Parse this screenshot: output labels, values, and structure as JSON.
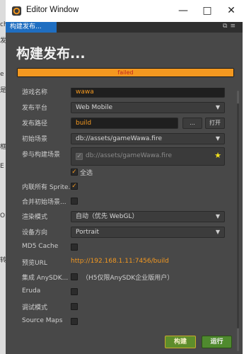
{
  "background_window": {
    "partial_labels": [
      "ch",
      "发",
      "e",
      "是",
      "框",
      "E",
      "O",
      "转"
    ]
  },
  "window": {
    "title": "Editor Window"
  },
  "tab": {
    "label": "构建发布..."
  },
  "panel": {
    "heading": "构建发布...",
    "progress": {
      "status": "failed",
      "fraction": 1.0,
      "color": "#f39820"
    }
  },
  "form": {
    "game_name": {
      "label": "游戏名称",
      "value": "wawa"
    },
    "platform": {
      "label": "发布平台",
      "value": "Web Mobile"
    },
    "path": {
      "label": "发布路径",
      "value": "build",
      "browse_label": "...",
      "open_label": "打开"
    },
    "start_scene": {
      "label": "初始场景",
      "value": "db://assets/gameWawa.fire"
    },
    "build_scenes": {
      "label": "参与构建场景",
      "scene": "db://assets/gameWawa.fire",
      "select_all": "全选"
    },
    "inline_sprite": {
      "label": "内联所有 Sprite...",
      "checked": true
    },
    "merge_scene": {
      "label": "合并初始场景...",
      "checked": false
    },
    "render_mode": {
      "label": "渲染模式",
      "value": "自动（优先 WebGL）"
    },
    "orientation": {
      "label": "设备方向",
      "value": "Portrait"
    },
    "md5": {
      "label": "MD5 Cache",
      "checked": false
    },
    "preview_url": {
      "label": "预览URL",
      "value": "http://192.168.1.11:7456/build"
    },
    "anysdk": {
      "label": "集成 AnySDK...",
      "note": "（H5仅限AnySDK企业版用户）",
      "checked": false
    },
    "eruda": {
      "label": "Eruda",
      "checked": false
    },
    "debug": {
      "label": "调试模式",
      "checked": false
    },
    "source_maps": {
      "label": "Source Maps",
      "checked": false
    }
  },
  "footer": {
    "build_label": "构建",
    "run_label": "运行"
  },
  "colors": {
    "accent": "#f39820",
    "tab_blue": "#1f6ec1",
    "panel_bg": "#484848",
    "run_green": "#4f8a2e"
  }
}
